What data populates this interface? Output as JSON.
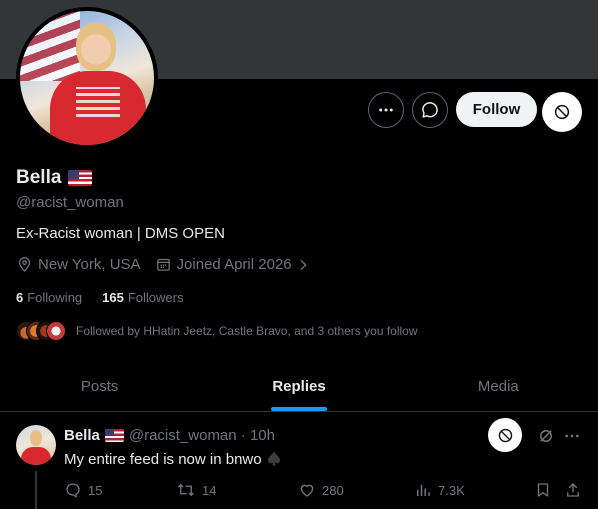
{
  "profile": {
    "display_name": "Bella",
    "handle": "@racist_woman",
    "bio": "Ex-Racist woman | DMS OPEN",
    "location": "New York, USA",
    "joined": "Joined April 2026",
    "following_count": "6",
    "following_label": "Following",
    "followers_count": "165",
    "followers_label": "Followers",
    "followed_by": "Followed by HHatin Jeetz, Castle Bravo, and 3 others you follow"
  },
  "actions": {
    "follow_label": "Follow"
  },
  "tabs": [
    {
      "label": "Posts",
      "active": false
    },
    {
      "label": "Replies",
      "active": true
    },
    {
      "label": "Media",
      "active": false
    }
  ],
  "tweet": {
    "name": "Bella",
    "handle_time": "@racist_woman · 10h",
    "text": "My entire feed is now in bnwo",
    "replies": "15",
    "reposts": "14",
    "likes": "280",
    "views": "7.3K"
  },
  "colors": {
    "accent": "#1d9bf0",
    "muted": "#71767b",
    "background": "#000000",
    "banner": "#333639"
  },
  "icons": [
    "more-icon",
    "message-icon",
    "block-icon",
    "location-icon",
    "calendar-icon",
    "chevron-right-icon",
    "spade-icon",
    "grok-icon",
    "reply-icon",
    "repost-icon",
    "like-icon",
    "views-icon",
    "bookmark-icon",
    "share-icon",
    "us-flag-icon"
  ]
}
